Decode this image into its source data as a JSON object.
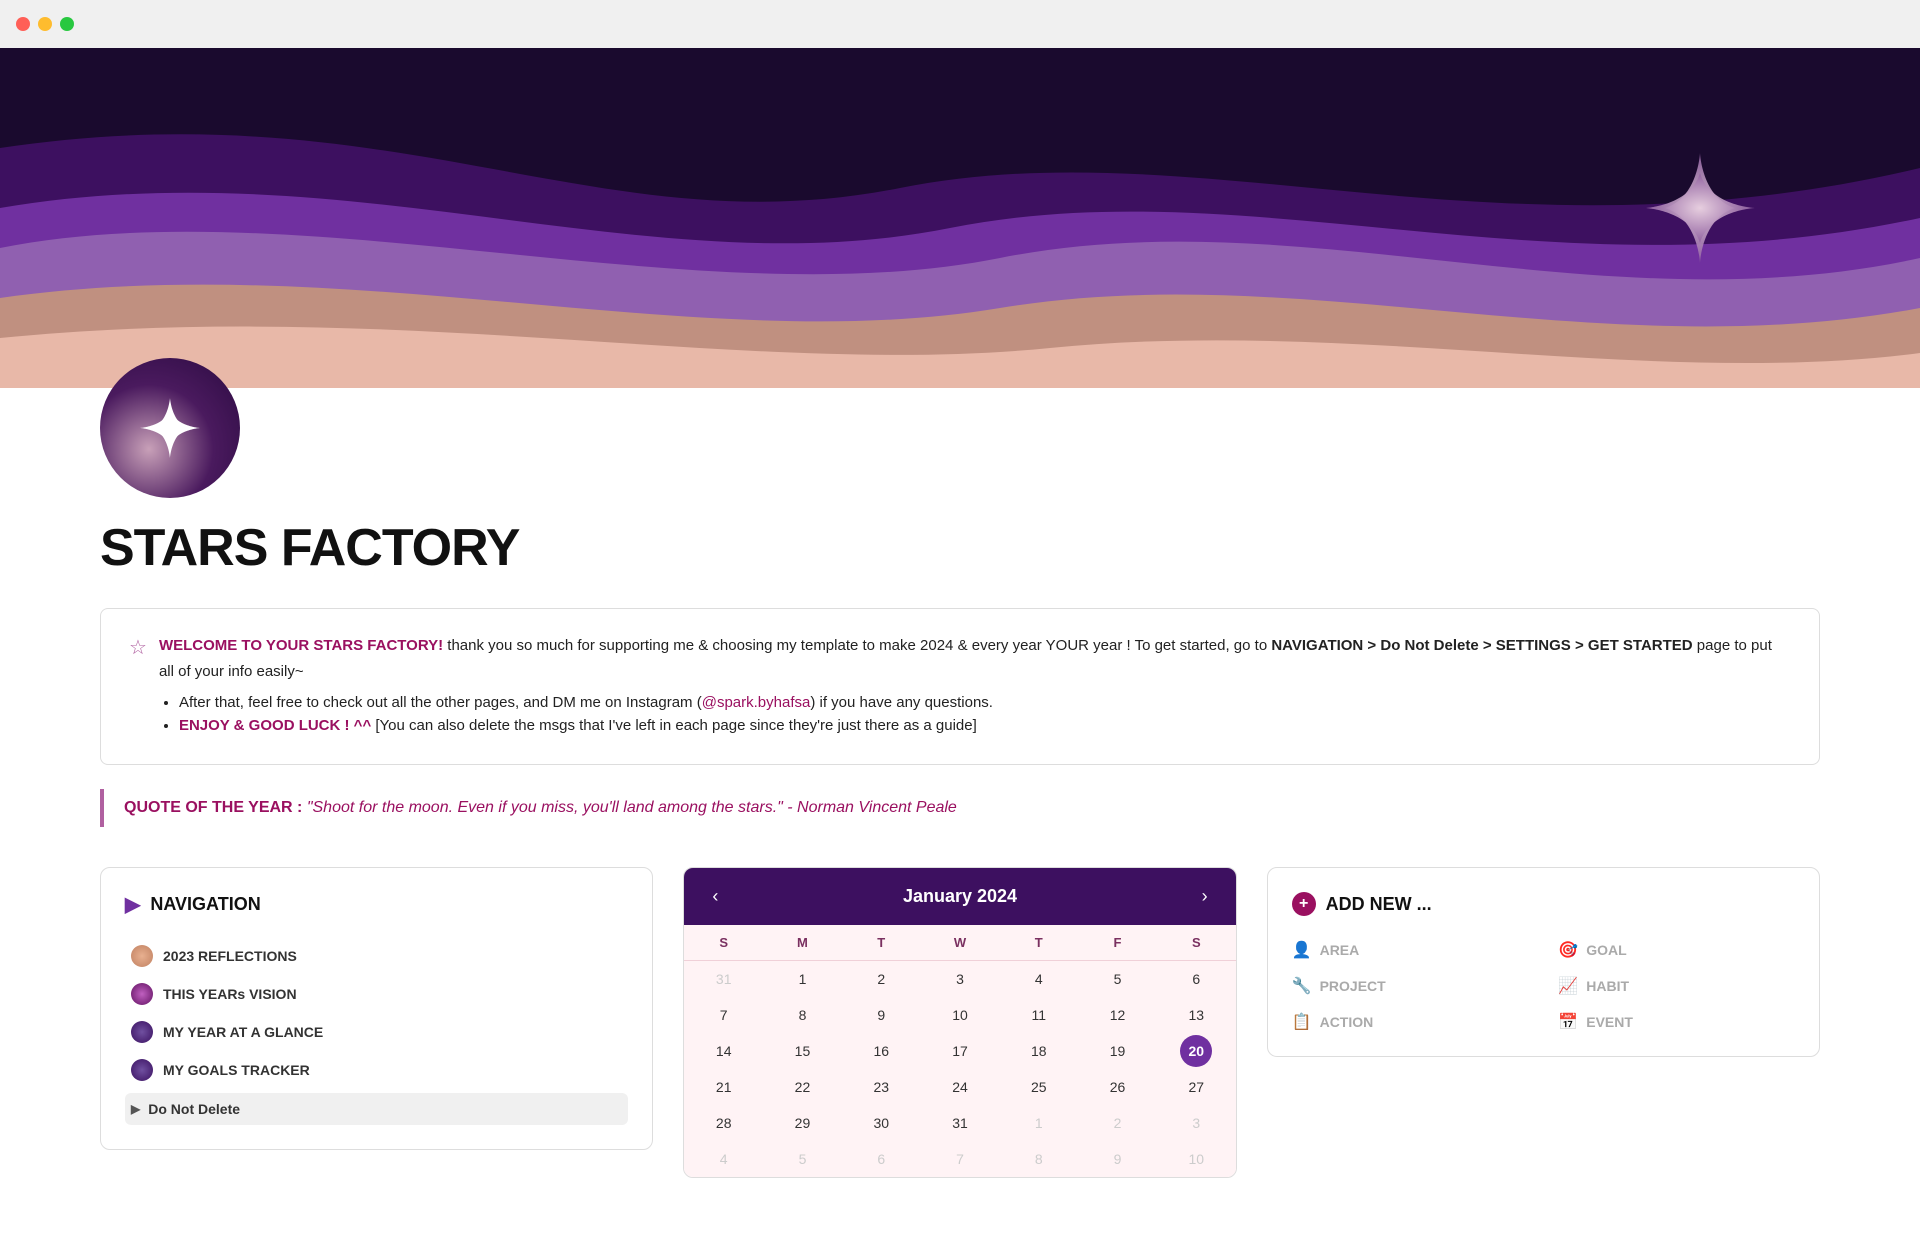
{
  "titlebar": {
    "traffic_lights": [
      "red",
      "yellow",
      "green"
    ]
  },
  "hero": {
    "background_color": "#1a0a2e"
  },
  "logo": {
    "alt": "Stars Factory Logo"
  },
  "page_title": "STARS FACTORY",
  "welcome": {
    "star_icon": "☆",
    "highlight": "WELCOME TO YOUR STARS FACTORY!",
    "body": " thank you so much for supporting me & choosing my template to make 2024 & every year YOUR year !  To get started, go to ",
    "nav_bold": "NAVIGATION > Do Not Delete > SETTINGS > GET STARTED",
    "body2": " page to put all of your info easily~",
    "bullet1_prefix": "After that, feel free to check out all the other pages, and DM me on Instagram (",
    "bullet1_link": "@spark.byhafsa",
    "bullet1_suffix": ") if you have any questions.",
    "bullet2_enjoy": "ENJOY & GOOD LUCK ! ^^",
    "bullet2_rest": " [You can also delete the msgs that I've left in each page since they're just there as a guide]"
  },
  "quote": {
    "label": "QUOTE OF THE YEAR : ",
    "text": "\"Shoot for the moon. Even if you miss, you'll land among the stars.\" - ",
    "author": "Norman Vincent Peale"
  },
  "navigation": {
    "title": "NAVIGATION",
    "items": [
      {
        "label": "2023 REFLECTIONS",
        "icon_class": "nav-icon-peach"
      },
      {
        "label": "THIS YEARs VISION",
        "icon_class": "nav-icon-purple"
      },
      {
        "label": "MY YEAR AT A GLANCE",
        "icon_class": "nav-icon-dark"
      },
      {
        "label": "MY GOALS TRACKER",
        "icon_class": "nav-icon-dark"
      }
    ],
    "toggle_label": "Do Not Delete"
  },
  "calendar": {
    "month_label": "January 2024",
    "day_names": [
      "S",
      "M",
      "T",
      "W",
      "T",
      "F",
      "S"
    ],
    "weeks": [
      [
        {
          "day": 31,
          "other": true
        },
        {
          "day": 1
        },
        {
          "day": 2
        },
        {
          "day": 3
        },
        {
          "day": 4
        },
        {
          "day": 5
        },
        {
          "day": 6
        }
      ],
      [
        {
          "day": 7
        },
        {
          "day": 8
        },
        {
          "day": 9
        },
        {
          "day": 10
        },
        {
          "day": 11
        },
        {
          "day": 12
        },
        {
          "day": 13
        }
      ],
      [
        {
          "day": 14
        },
        {
          "day": 15
        },
        {
          "day": 16
        },
        {
          "day": 17
        },
        {
          "day": 18
        },
        {
          "day": 19
        },
        {
          "day": 20,
          "today": true
        }
      ],
      [
        {
          "day": 21
        },
        {
          "day": 22
        },
        {
          "day": 23
        },
        {
          "day": 24
        },
        {
          "day": 25
        },
        {
          "day": 26
        },
        {
          "day": 27
        }
      ],
      [
        {
          "day": 28
        },
        {
          "day": 29
        },
        {
          "day": 30
        },
        {
          "day": 31
        },
        {
          "day": 1,
          "other": true
        },
        {
          "day": 2,
          "other": true
        },
        {
          "day": 3,
          "other": true
        }
      ],
      [
        {
          "day": 4,
          "other": true
        },
        {
          "day": 5,
          "other": true
        },
        {
          "day": 6,
          "other": true
        },
        {
          "day": 7,
          "other": true
        },
        {
          "day": 8,
          "other": true
        },
        {
          "day": 9,
          "other": true
        },
        {
          "day": 10,
          "other": true
        }
      ]
    ]
  },
  "add_new": {
    "title": "ADD NEW ...",
    "plus_icon": "+",
    "items": [
      {
        "icon": "👤",
        "label": "AREA"
      },
      {
        "icon": "🎯",
        "label": "GOAL"
      },
      {
        "icon": "🔧",
        "label": "PROJECT"
      },
      {
        "icon": "📈",
        "label": "HABIT"
      },
      {
        "icon": "📋",
        "label": "ACTION"
      },
      {
        "icon": "📅",
        "label": "EVENT"
      }
    ]
  }
}
